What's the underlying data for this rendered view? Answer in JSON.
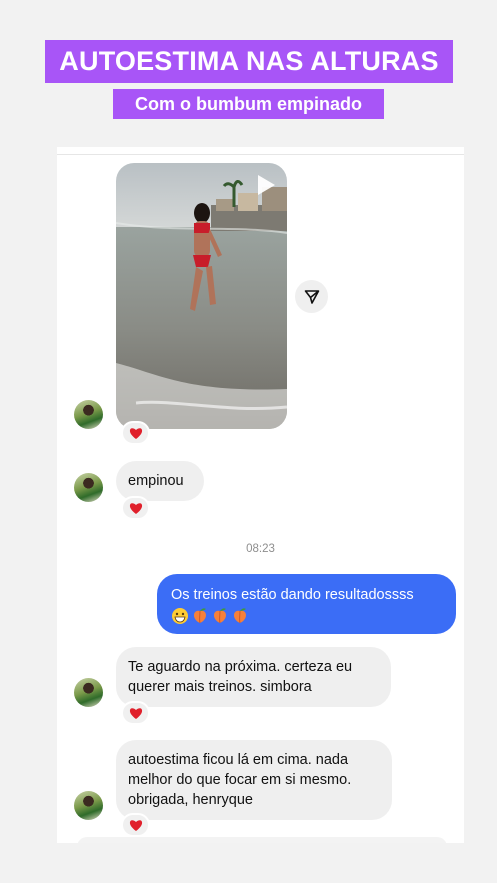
{
  "banner": {
    "headline": "AUTOESTIMA NAS ALTURAS",
    "subline": "Com o bumbum empinado"
  },
  "chat": {
    "timestamp": "08:23",
    "messages": [
      {
        "type": "media",
        "direction": "incoming",
        "reaction": "heart"
      },
      {
        "type": "text",
        "direction": "incoming",
        "text": "empinou",
        "reaction": "heart"
      },
      {
        "type": "text",
        "direction": "outgoing",
        "text": "Os treinos estão dando resultadossss",
        "emojis": [
          "grin",
          "peach",
          "peach",
          "peach"
        ]
      },
      {
        "type": "text",
        "direction": "incoming",
        "text": "Te aguardo na próxima. certeza eu querer mais treinos. simbora",
        "reaction": "heart"
      },
      {
        "type": "text",
        "direction": "incoming",
        "text": "autoestima ficou lá em cima. nada melhor do que focar em si mesmo. obrigada, henryque",
        "reaction": "heart"
      }
    ],
    "colors": {
      "outgoing": "#3b6df6",
      "incoming": "#efefef",
      "banner": "#a855f7"
    }
  }
}
